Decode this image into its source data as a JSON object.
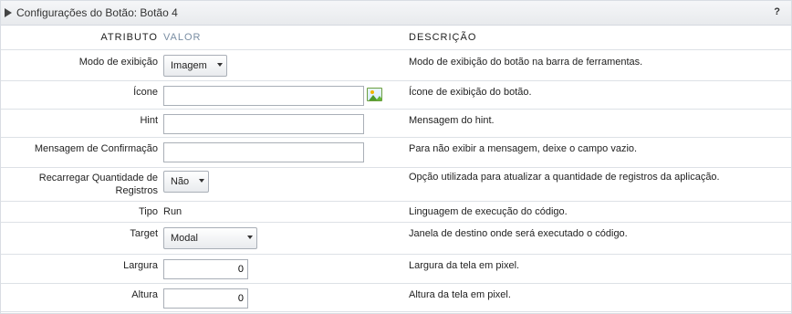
{
  "panel": {
    "title": "Configurações do Botão: Botão 4",
    "help": "?"
  },
  "columns": {
    "attribute": "ATRIBUTO",
    "value": "VALOR",
    "description": "DESCRIÇÃO"
  },
  "rows": {
    "display_mode": {
      "label": "Modo de exibição",
      "value": "Imagem",
      "description": "Modo de exibição do botão na barra de ferramentas."
    },
    "icon": {
      "label": "Ícone",
      "value": "",
      "description": "Ícone de exibição do botão."
    },
    "hint": {
      "label": "Hint",
      "value": "",
      "description": "Mensagem do hint."
    },
    "confirm_message": {
      "label": "Mensagem de Confirmação",
      "value": "",
      "description": "Para não exibir a mensagem, deixe o campo vazio."
    },
    "reload_count": {
      "label_line1": "Recarregar Quantidade de",
      "label_line2": "Registros",
      "value": "Não",
      "description": "Opção utilizada para atualizar a quantidade de registros da aplicação."
    },
    "type": {
      "label": "Tipo",
      "value": "Run",
      "description": "Linguagem de execução do código."
    },
    "target": {
      "label": "Target",
      "value": "Modal",
      "description": "Janela de destino onde será executado o código."
    },
    "width": {
      "label": "Largura",
      "value": "0",
      "description": "Largura da tela em pixel."
    },
    "height": {
      "label": "Altura",
      "value": "0",
      "description": "Altura da tela em pixel."
    }
  },
  "icons": {
    "expand": "triangle-right-icon",
    "image_picker": "image-picker-icon",
    "dropdown": "chevron-down-icon"
  }
}
